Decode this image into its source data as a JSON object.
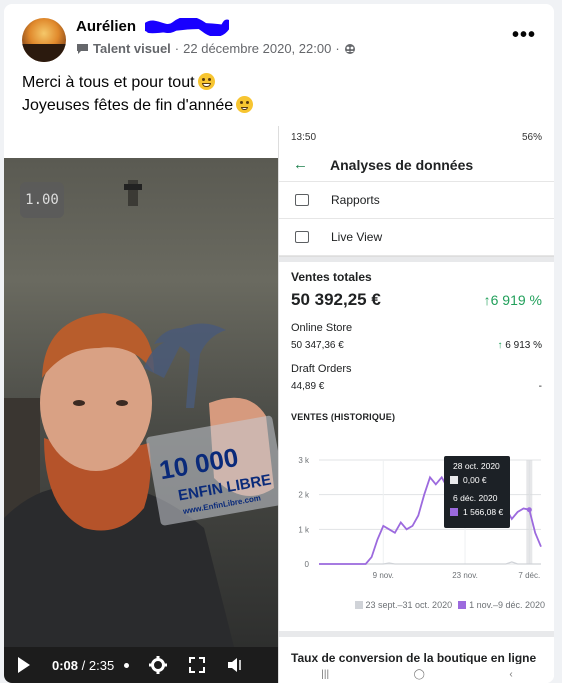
{
  "post": {
    "author_first": "Aurélien",
    "badge_label": "Talent visuel",
    "date": "22 décembre 2020, 22:00",
    "more_label": "•••",
    "text_line1": "Merci à tous et pour tout",
    "text_line2": "Joyeuses fêtes de fin d'année"
  },
  "video": {
    "speed": "1.00",
    "current_time": "0:08",
    "duration": "/ 2:35",
    "trophy_text_line1": "10 000",
    "trophy_text_line2": "ENFIN LIBRE",
    "trophy_text_line3": "www.EnfinLibre.com"
  },
  "phone": {
    "status_time": "13:50",
    "status_battery": "56%",
    "title": "Analyses de données",
    "menu": [
      {
        "label": "Rapports"
      },
      {
        "label": "Live View"
      }
    ],
    "total_sales_title": "Ventes totales",
    "total_sales_value": "50 392,25 €",
    "total_sales_pct": "6 919 %",
    "online_store_label": "Online Store",
    "online_store_value": "50 347,36 €",
    "online_store_pct": "6 913 %",
    "draft_orders_label": "Draft Orders",
    "draft_orders_value": "44,89 €",
    "draft_orders_pct": "-",
    "history_label": "VENTES (HISTORIQUE)",
    "tooltip": {
      "date1": "28 oct. 2020",
      "value1": "0,00 €",
      "date2": "6 déc. 2020",
      "value2": "1 566,08 €"
    },
    "legend_prev": "23 sept.–31 oct. 2020",
    "legend_curr": "1 nov.–9 déc. 2020",
    "conversion_title": "Taux de conversion de la boutique en ligne"
  },
  "colors": {
    "accent_green": "#22a05b",
    "series_current": "#9c6ade",
    "series_previous": "#d0d3d8"
  },
  "chart_data": {
    "type": "line",
    "title": "VENTES (HISTORIQUE)",
    "x_tick_labels": [
      "9 nov.",
      "23 nov.",
      "7 déc."
    ],
    "y_tick_labels": [
      "0",
      "1 k",
      "2 k",
      "3 k"
    ],
    "ylim": [
      0,
      3000
    ],
    "grid": true,
    "legend_position": "bottom-right",
    "series": [
      {
        "name": "1 nov.–9 déc. 2020",
        "values": [
          0,
          0,
          0,
          0,
          0,
          0,
          0,
          0,
          0,
          200,
          700,
          1100,
          1000,
          900,
          1200,
          1000,
          1100,
          1400,
          2000,
          2500,
          2300,
          2500,
          2200,
          2500,
          2000,
          2500,
          2400,
          1800,
          1400,
          1900,
          1500,
          1400,
          1600,
          1300,
          1500,
          1600,
          1566,
          900,
          500
        ]
      },
      {
        "name": "23 sept.–31 oct. 2020",
        "values": [
          0,
          0,
          0,
          0,
          0,
          0,
          0,
          0,
          0,
          0,
          0,
          0,
          30,
          0,
          0,
          0,
          0,
          0,
          0,
          0,
          0,
          0,
          0,
          0,
          0,
          0,
          0,
          0,
          0,
          0,
          0,
          0,
          0,
          60,
          0,
          0,
          0,
          0,
          0
        ]
      }
    ]
  }
}
